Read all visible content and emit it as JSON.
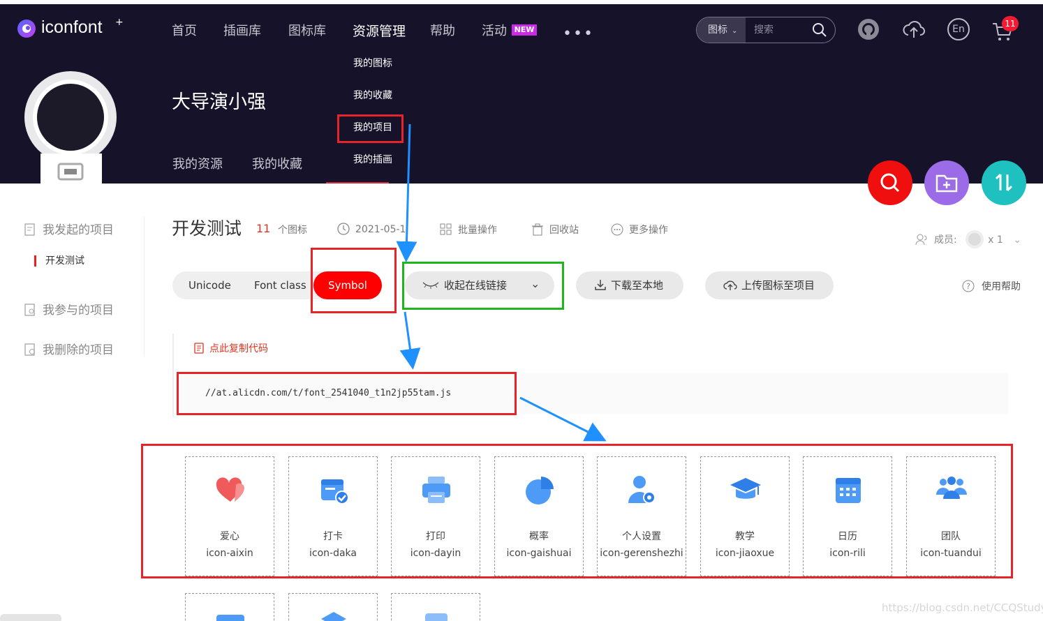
{
  "header": {
    "logo_text": "iconfont",
    "logo_sup": "+",
    "nav": [
      {
        "label": "首页"
      },
      {
        "label": "插画库"
      },
      {
        "label": "图标库"
      },
      {
        "label": "资源管理"
      },
      {
        "label": "帮助"
      },
      {
        "label": "活动"
      }
    ],
    "new_badge": "NEW",
    "more": "•••",
    "search_type": "图标",
    "search_placeholder": "搜索",
    "cart_count": "11",
    "lang": "En"
  },
  "dropdown": {
    "items": [
      "我的图标",
      "我的收藏",
      "我的项目",
      "我的插画"
    ]
  },
  "profile": {
    "username": "大导演小强",
    "subnav": [
      "我的资源",
      "我的收藏"
    ]
  },
  "sidebar": {
    "items": [
      "我发起的项目",
      "我参与的项目",
      "我删除的项目"
    ],
    "active_project": "开发测试"
  },
  "project": {
    "title": "开发测试",
    "count": "11",
    "count_unit": "个图标",
    "date": "2021-05-1",
    "batch": "批量操作",
    "recycle": "回收站",
    "more_ops": "更多操作",
    "member_label": "成员:",
    "member_count": "x 1"
  },
  "tabs": [
    "Unicode",
    "Font class",
    "Symbol"
  ],
  "actions": {
    "collapse_link": "收起在线链接",
    "download": "下载至本地",
    "upload": "上传图标至项目",
    "help": "使用帮助"
  },
  "code": {
    "copy_label": "点此复制代码",
    "url": "//at.alicdn.com/t/font_2541040_t1n2jp55tam.js"
  },
  "icons": [
    {
      "name": "爱心",
      "code": "icon-aixin",
      "icon": "heart-icon"
    },
    {
      "name": "打卡",
      "code": "icon-daka",
      "icon": "calendar-check-icon"
    },
    {
      "name": "打印",
      "code": "icon-dayin",
      "icon": "printer-icon"
    },
    {
      "name": "概率",
      "code": "icon-gaishuai",
      "icon": "pie-chart-icon"
    },
    {
      "name": "个人设置",
      "code": "icon-gerenshezhi",
      "icon": "user-settings-icon"
    },
    {
      "name": "教学",
      "code": "icon-jiaoxue",
      "icon": "graduation-cap-icon"
    },
    {
      "name": "日历",
      "code": "icon-rili",
      "icon": "calendar-icon"
    },
    {
      "name": "团队",
      "code": "icon-tuandui",
      "icon": "team-icon"
    }
  ],
  "watermark": "https://blog.csdn.net/CCQStudy",
  "colors": {
    "header_bg": "#161229",
    "accent_red": "#ff0000",
    "annotation_red": "#e8242b",
    "annotation_green": "#1db61c",
    "arrow_blue": "#1e90ff",
    "icon_blue": "#4d9bf7",
    "fab_search": "#f00f0f",
    "fab_folder": "#9b6be8",
    "fab_sort": "#1fc0c0"
  }
}
